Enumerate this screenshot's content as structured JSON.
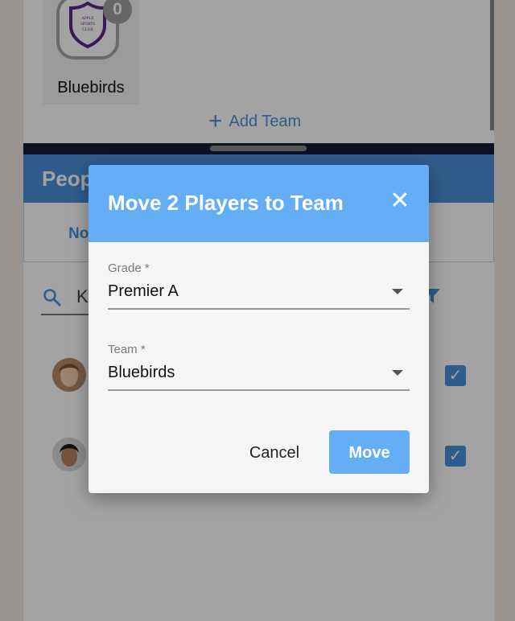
{
  "background": {
    "team_card": {
      "badge_count": "0",
      "logo_text": [
        "APPLE",
        "SPORTS",
        "CLUB"
      ],
      "name": "Bluebirds"
    },
    "add_team_label": "Add Team",
    "people_header_prefix": "Peop",
    "tab_label_prefix": "No",
    "search_partial": "K",
    "players": [
      {
        "checked": true
      },
      {
        "checked": true
      }
    ]
  },
  "dialog": {
    "title": "Move 2 Players to Team",
    "close_glyph": "✕",
    "grade": {
      "label": "Grade *",
      "value": "Premier A"
    },
    "team": {
      "label": "Team *",
      "value": "Bluebirds"
    },
    "cancel_label": "Cancel",
    "move_label": "Move"
  },
  "colors": {
    "accent": "#4a90d9",
    "dialog_header": "#64aef6",
    "shield": "#5a2a86"
  },
  "icons": [
    "plus-icon",
    "search-icon",
    "filter-icon",
    "close-icon",
    "chevron-down-icon",
    "checkbox-checked-icon",
    "shield-icon"
  ]
}
